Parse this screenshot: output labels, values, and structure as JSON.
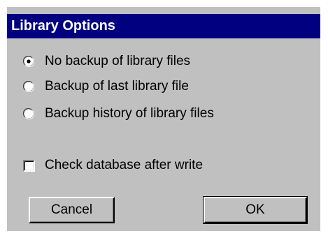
{
  "dialog": {
    "title": "Library Options",
    "options": [
      {
        "label": "No backup of library files",
        "selected": true
      },
      {
        "label": "Backup of last library file",
        "selected": false
      },
      {
        "label": "Backup history of library files",
        "selected": false
      }
    ],
    "check_database": {
      "label": "Check database after write",
      "checked": false
    },
    "buttons": {
      "cancel_label": "Cancel",
      "ok_label": "OK"
    }
  },
  "colors": {
    "title_bar": "#000080",
    "dialog_face": "#c0c0c0",
    "title_text": "#ffffff"
  }
}
